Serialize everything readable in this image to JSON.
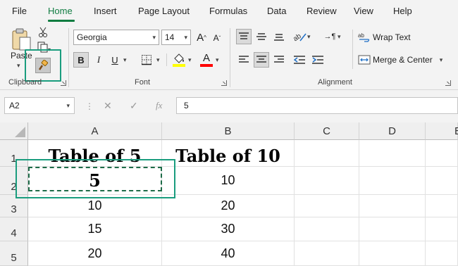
{
  "menu": {
    "tabs": [
      "File",
      "Home",
      "Insert",
      "Page Layout",
      "Formulas",
      "Data",
      "Review",
      "View",
      "Help"
    ],
    "active_tab": "Home"
  },
  "ribbon": {
    "clipboard": {
      "label": "Clipboard",
      "paste_label": "Paste"
    },
    "font": {
      "label": "Font",
      "font_name": "Georgia",
      "font_size": "14",
      "grow_label": "A",
      "shrink_label": "A",
      "bold_label": "B",
      "italic_label": "I",
      "underline_label": "U",
      "font_color_label": "A",
      "highlight_color": "#ffff00",
      "font_color": "#ff0000"
    },
    "alignment": {
      "label": "Alignment",
      "wrap_text_label": "Wrap Text",
      "merge_center_label": "Merge & Center"
    }
  },
  "formula_bar": {
    "name_box": "A2",
    "cancel_icon": "✕",
    "enter_icon": "✓",
    "fx_label": "fx",
    "value": "5"
  },
  "sheet": {
    "columns": [
      "A",
      "B",
      "C",
      "D",
      "E"
    ],
    "rows": [
      "1",
      "2",
      "3",
      "4",
      "5"
    ],
    "cells": {
      "A1": "Table of 5",
      "B1": "Table of 10",
      "A2": "5",
      "B2": "10",
      "A3": "10",
      "B3": "20",
      "A4": "15",
      "B4": "30",
      "A5": "20",
      "B5": "40"
    }
  },
  "colors": {
    "accent": "#107c41",
    "highlight_box": "#1a9d7e"
  }
}
